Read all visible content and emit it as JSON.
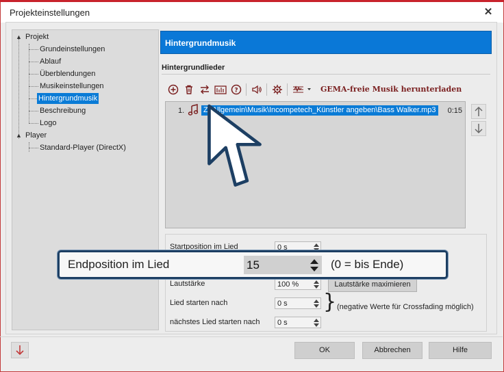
{
  "window": {
    "title": "Projekteinstellungen",
    "close_glyph": "✕"
  },
  "tree": {
    "items": [
      {
        "label": "Projekt",
        "level": 0
      },
      {
        "label": "Grundeinstellungen",
        "level": 1
      },
      {
        "label": "Ablauf",
        "level": 1
      },
      {
        "label": "Überblendungen",
        "level": 1
      },
      {
        "label": "Musikeinstellungen",
        "level": 1
      },
      {
        "label": "Hintergrundmusik",
        "level": 1,
        "selected": true
      },
      {
        "label": "Beschreibung",
        "level": 1
      },
      {
        "label": "Logo",
        "level": 1
      },
      {
        "label": "Player",
        "level": 0
      },
      {
        "label": "Standard-Player (DirectX)",
        "level": 1
      }
    ]
  },
  "header": {
    "title": "Hintergrundmusik"
  },
  "section": {
    "title": "Hintergrundlieder"
  },
  "toolbar": {
    "icons": [
      "add-icon",
      "delete-icon",
      "swap-icon",
      "equalizer-icon",
      "help-icon",
      "speaker-icon",
      "gear-icon",
      "waveform-menu-icon"
    ],
    "gema_link": "GEMA-freie Musik herunterladen"
  },
  "tracks": [
    {
      "num": "1.",
      "path": "Z:\\Allgemein\\Musik\\Incompetech_Künstler angeben\\Bass Walker.mp3",
      "time": "0:15"
    }
  ],
  "settings": {
    "start_label": "Startposition im Lied",
    "start_value": "0 s",
    "volume_label": "Lautstärke",
    "volume_value": "100 %",
    "volume_button": "Lautstärke maximieren",
    "start_after_label": "Lied starten nach",
    "start_after_value": "0 s",
    "next_after_label": "nächstes Lied starten nach",
    "next_after_value": "0 s",
    "negative_hint": "(negative Werte für Crossfading möglich)"
  },
  "callout": {
    "label": "Endposition im Lied",
    "value": "15",
    "hint": "(0 = bis Ende)"
  },
  "footer": {
    "ok": "OK",
    "cancel": "Abbrechen",
    "help": "Hilfe"
  },
  "colors": {
    "accent": "#0a78d7",
    "window_border": "#c23a3a",
    "gema_link": "#7a1f1f"
  }
}
